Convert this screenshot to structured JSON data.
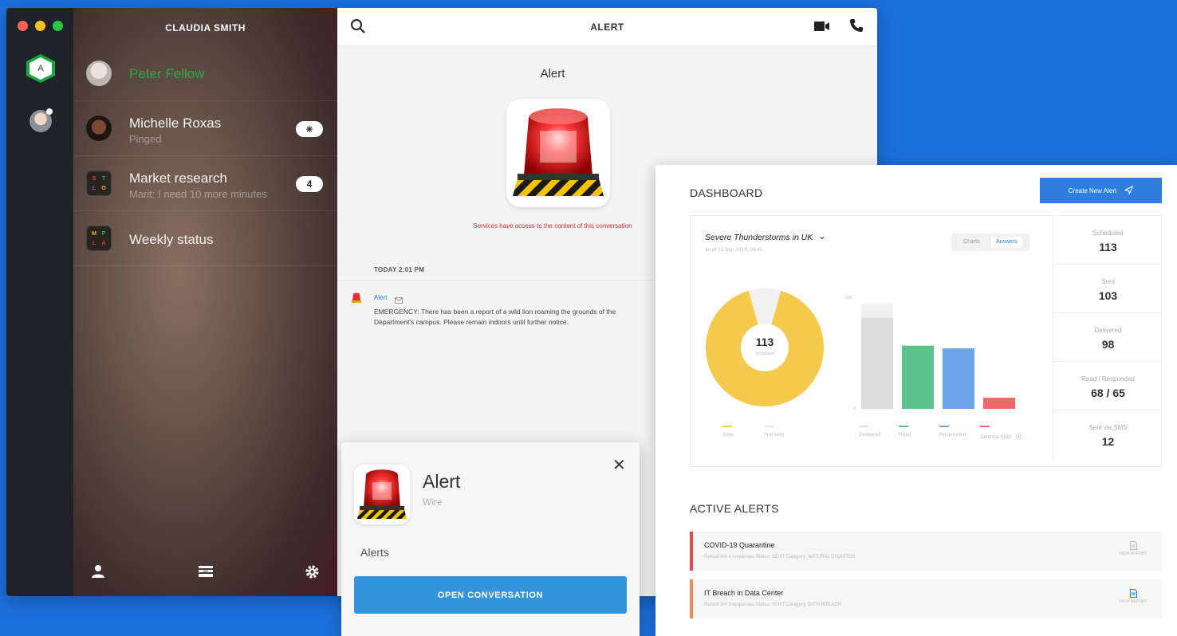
{
  "window": {
    "user_name": "CLAUDIA SMITH"
  },
  "rail": {
    "workspace_initial": "A"
  },
  "conversations": [
    {
      "name": "Peter Fellow",
      "sub": "",
      "badge": "",
      "color": "#2ea84a"
    },
    {
      "name": "Michelle Roxas",
      "sub": "Pinged",
      "badge": ""
    },
    {
      "name": "Market research",
      "sub": "Marit: I need 10 more minutes",
      "badge": "4",
      "tiles": [
        "S",
        "T",
        "L",
        "O"
      ]
    },
    {
      "name": "Weekly status",
      "sub": "",
      "badge": "",
      "tiles": [
        "M",
        "P",
        "L",
        "A"
      ]
    }
  ],
  "chat": {
    "title": "ALERT",
    "hero_title": "Alert",
    "access_note": "Services have access to the content of this conversation",
    "day_label": "TODAY 2:01 PM",
    "sender": "Alert",
    "message": "EMERGENCY: There has been a report of a wild lion roaming the grounds of the Department's campus. Please remain indoors until further notice."
  },
  "popup": {
    "title": "Alert",
    "subtitle": "Wire",
    "section": "Alerts",
    "button": "OPEN CONVERSATION"
  },
  "dashboard": {
    "title": "DASHBOARD",
    "create_button": "Create New Alert",
    "event_name": "Severe Thunderstorms in UK",
    "event_date": "as of 13 Sep 2019, 09:41",
    "tabs": [
      "Charts",
      "Answers"
    ],
    "stats": [
      {
        "label": "Scheduled",
        "value": "113"
      },
      {
        "label": "Sent",
        "value": "103"
      },
      {
        "label": "Delivered",
        "value": "98"
      },
      {
        "label": "Read / Responded",
        "value": "68 / 65"
      },
      {
        "label": "Sent via SMS",
        "value": "12"
      }
    ],
    "donut": {
      "center_value": "113",
      "center_label": "Scheduled",
      "legend": [
        "Sent",
        "Not sent"
      ]
    },
    "bars_legend": [
      "Delivered",
      "Read",
      "Responded",
      "Sent via SMS"
    ],
    "bars_axis": [
      "100",
      "0"
    ],
    "active_title": "ACTIVE ALERTS",
    "alerts": [
      {
        "name": "COVID-19 Quarantine",
        "meta": "Rebuilt 4/4     4 responses     Status: SENT     Category: NATURAL DISASTER",
        "report": "VIEW REPORT",
        "accent": "#e84a4a",
        "icon_color": "#bbbbbb"
      },
      {
        "name": "IT Breach in Data Center",
        "meta": "Rebuilt 3/4     3 responses     Status: SENT     Category: DATA BREACH",
        "report": "VIEW REPORT",
        "accent": "#f08a4b",
        "icon_color": "#2f7fe0"
      }
    ]
  },
  "chart_data": {
    "type": "bar",
    "donut": {
      "values": [
        103,
        10
      ],
      "labels": [
        "Sent",
        "Not sent"
      ],
      "colors": [
        "#f5c94c",
        "#f0f0f0"
      ]
    },
    "categories": [
      "Delivered",
      "Read",
      "Responded",
      "Sent via SMS"
    ],
    "values": [
      98,
      68,
      65,
      12
    ],
    "background": 113,
    "ylim": [
      0,
      120
    ],
    "colors": [
      "#dddddd",
      "#5bc48a",
      "#6aa3ea",
      "#f0686a"
    ]
  }
}
